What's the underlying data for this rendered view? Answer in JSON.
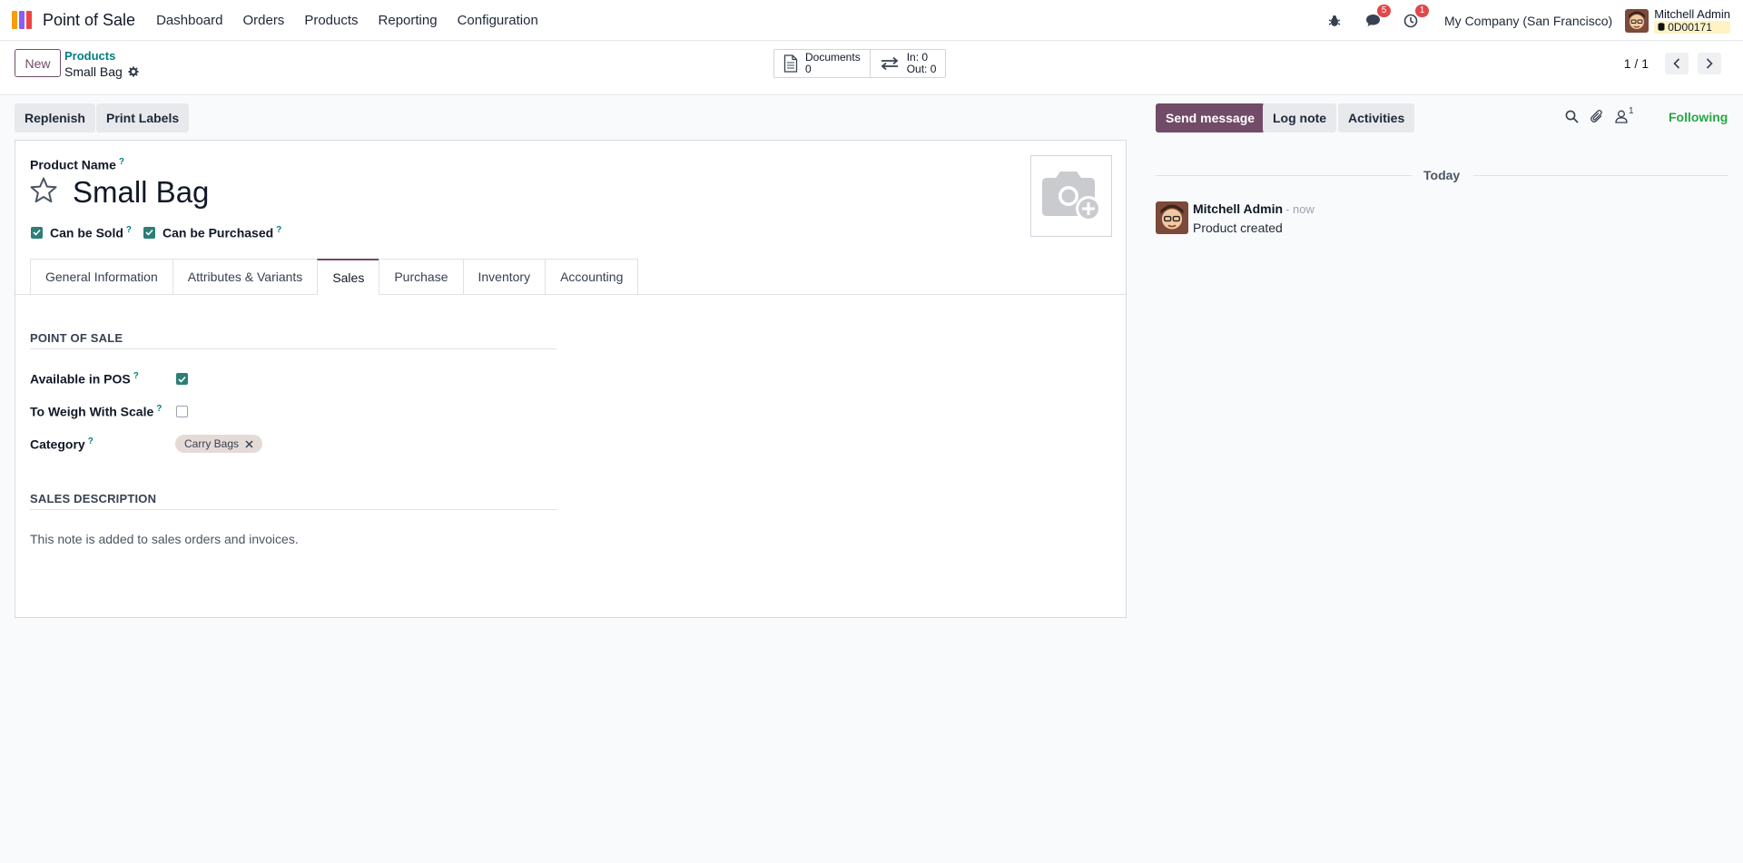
{
  "navbar": {
    "app_name": "Point of Sale",
    "menu": [
      "Dashboard",
      "Orders",
      "Products",
      "Reporting",
      "Configuration"
    ],
    "messages_count": "5",
    "activities_count": "1",
    "company": "My Company (San Francisco)",
    "user_name": "Mitchell Admin",
    "database": "0D00171",
    "icons": [
      "bug-icon",
      "chat-icon",
      "clock-icon"
    ]
  },
  "control_panel": {
    "new_label": "New",
    "breadcrumb": "Products",
    "record_name": "Small Bag",
    "smart_buttons": {
      "documents_label": "Documents",
      "documents_value": "0",
      "in_label": "In: 0",
      "out_label": "Out: 0"
    },
    "pager": "1 / 1"
  },
  "actions": {
    "replenish": "Replenish",
    "print_labels": "Print Labels"
  },
  "form": {
    "product_name_label": "Product Name",
    "product_name": "Small Bag",
    "help_mark": "?",
    "can_be_sold": "Can be Sold",
    "can_be_purchased": "Can be Purchased",
    "tabs": [
      "General Information",
      "Attributes & Variants",
      "Sales",
      "Purchase",
      "Inventory",
      "Accounting"
    ],
    "active_tab": "Sales",
    "pos_section": "POINT OF SALE",
    "available_in_pos": "Available in POS",
    "to_weigh": "To Weigh With Scale",
    "category_label": "Category",
    "category_tag": "Carry Bags",
    "sales_desc_section": "SALES DESCRIPTION",
    "sales_desc_placeholder": "This note is added to sales orders and invoices."
  },
  "chatter": {
    "send_message": "Send message",
    "log_note": "Log note",
    "activities": "Activities",
    "followers_count": "1",
    "following": "Following",
    "date_separator": "Today",
    "author": "Mitchell Admin",
    "time": "- now",
    "body": "Product created"
  },
  "colors": {
    "brand": "#714b67",
    "teal": "#017e84",
    "success": "#28a745",
    "badge": "#e0484b"
  }
}
